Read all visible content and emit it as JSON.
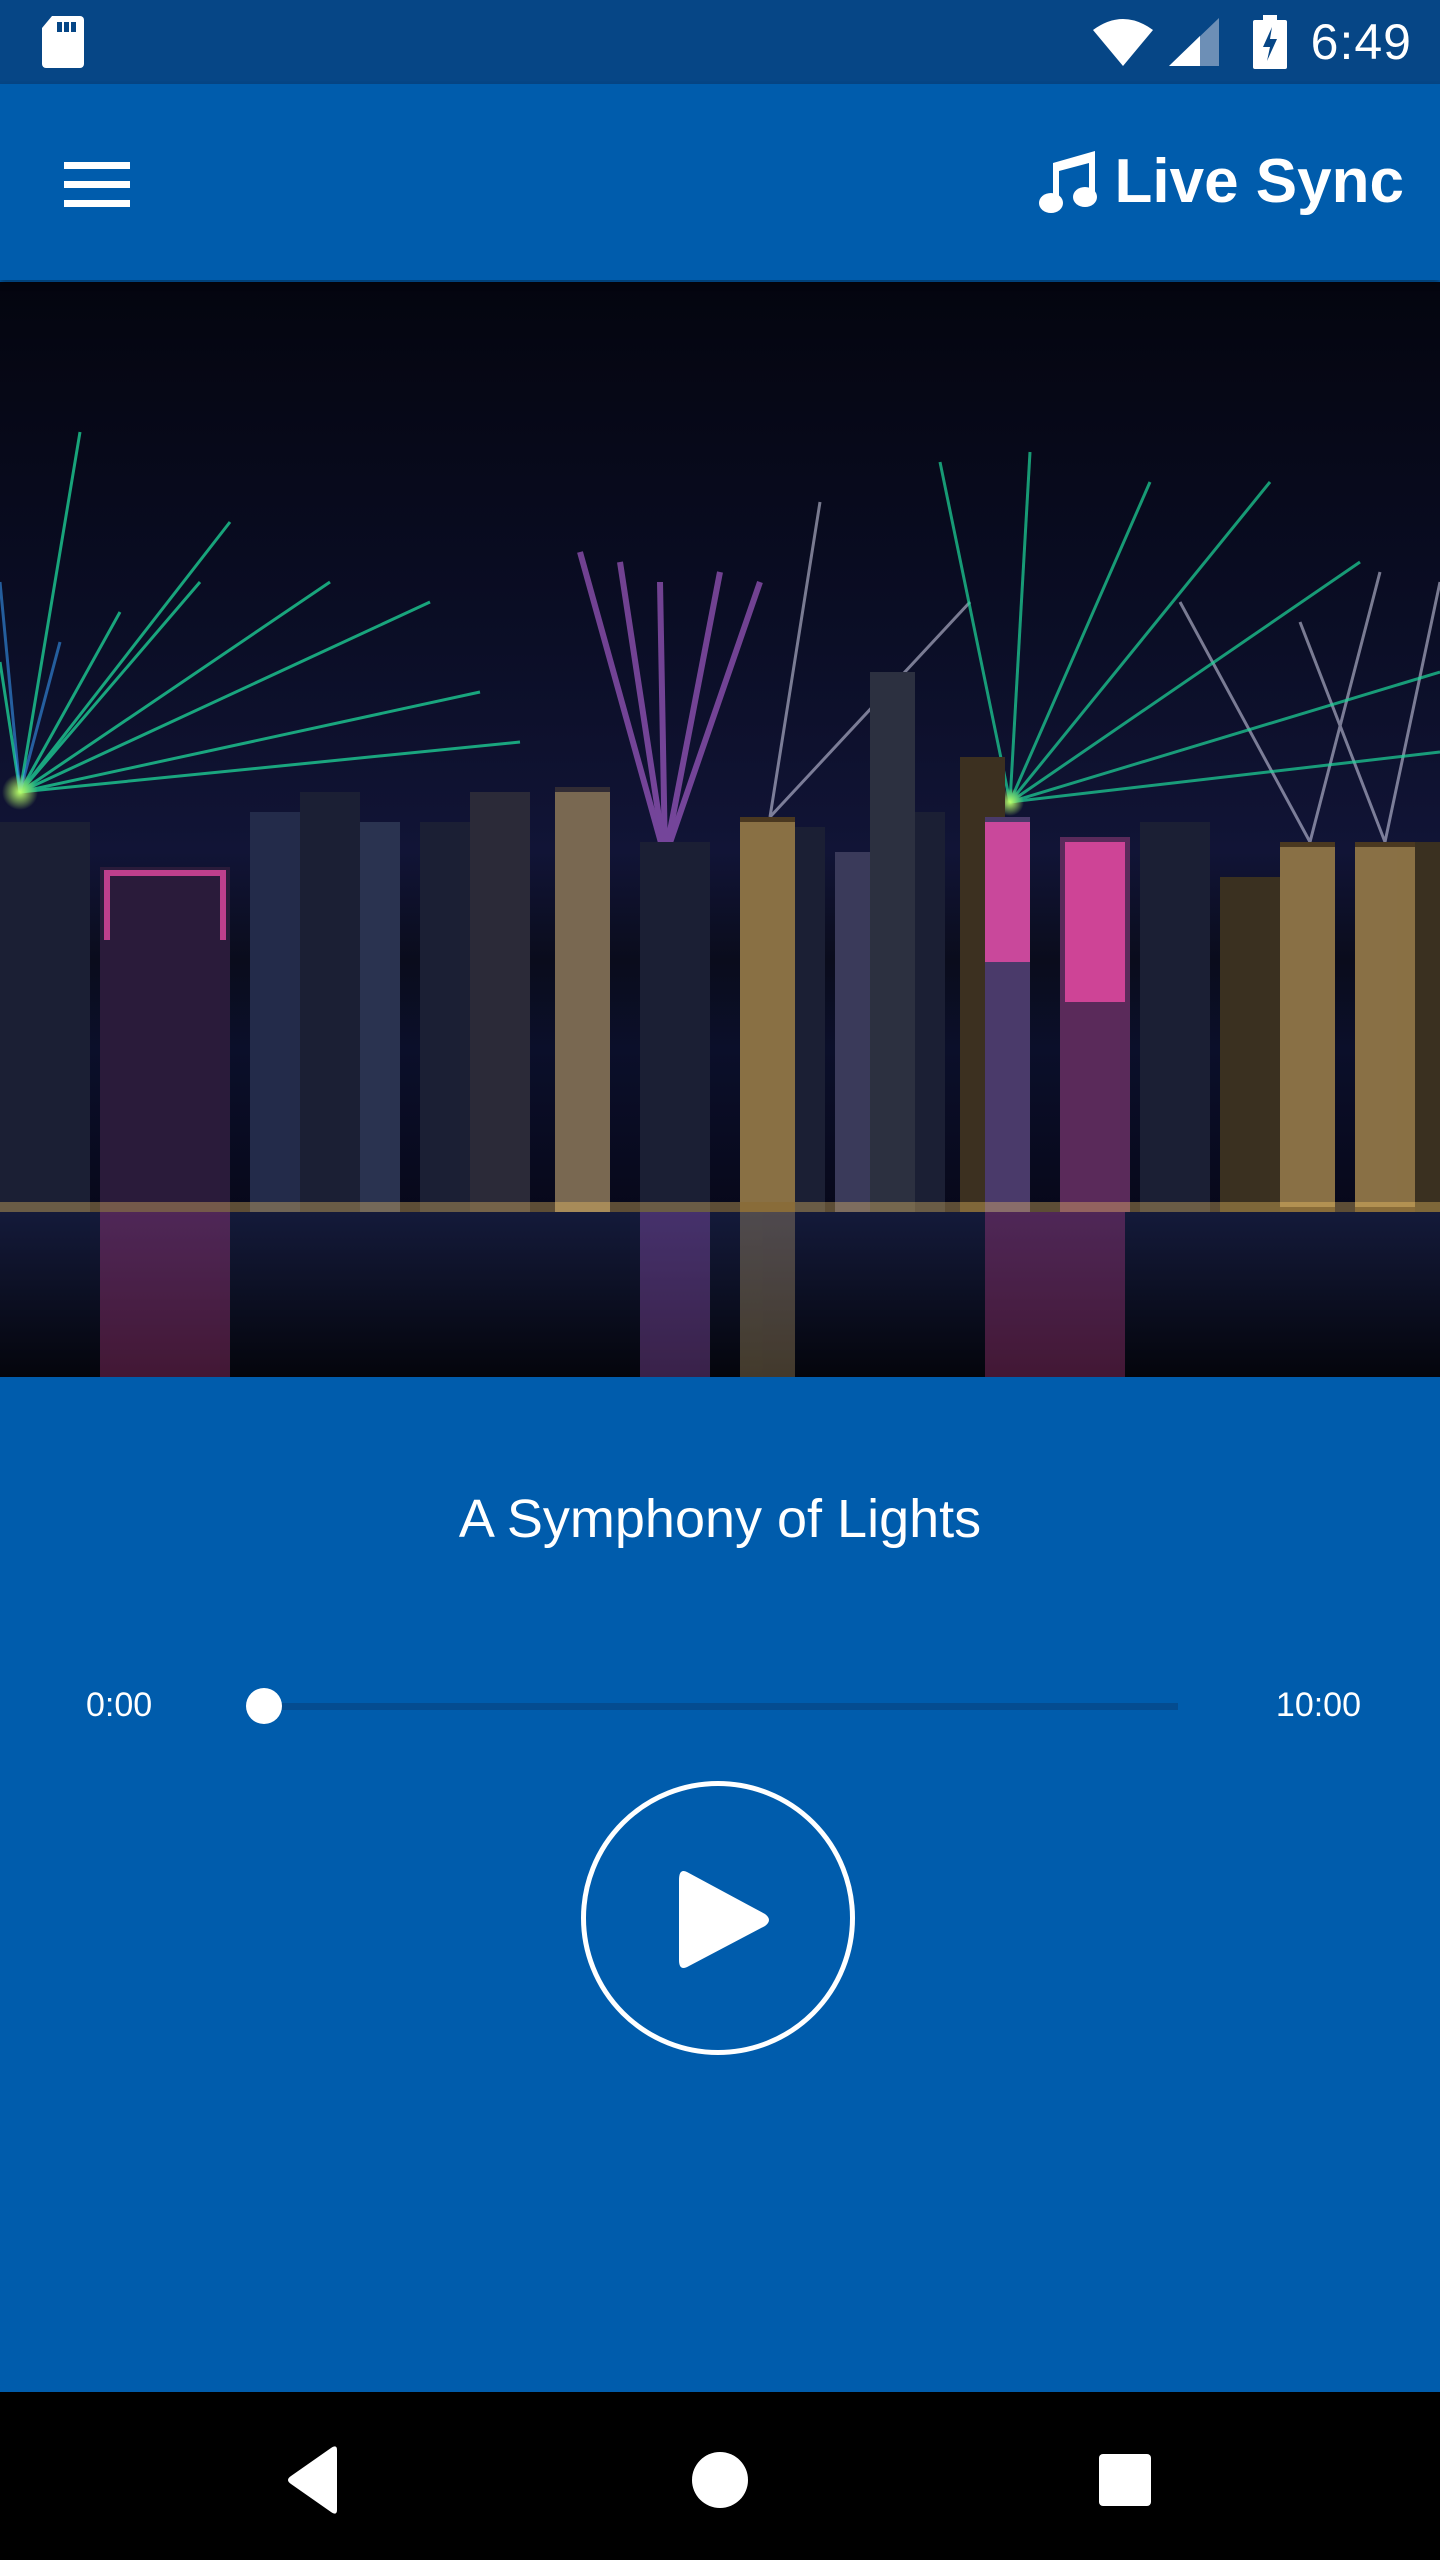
{
  "status_bar": {
    "time": "6:49",
    "icons": [
      "sd-card-icon",
      "wifi-icon",
      "cell-signal-icon",
      "battery-charging-icon"
    ]
  },
  "app_bar": {
    "title": "Live Sync",
    "menu_icon": "hamburger-menu-icon",
    "title_icon": "music-note-icon"
  },
  "hero": {
    "description": "Hong Kong skyline at night with laser light show over Victoria Harbour"
  },
  "player": {
    "track_title": "A Symphony of Lights",
    "elapsed": "0:00",
    "duration": "10:00",
    "progress": 0.0,
    "play_icon": "play-icon"
  },
  "nav_bar": {
    "buttons": [
      "back-icon",
      "home-icon",
      "recents-icon"
    ]
  },
  "colors": {
    "primary": "#005cac",
    "status_bar": "#064686",
    "seek_track": "#044c90",
    "nav_bar": "#000000",
    "foreground": "#ffffff"
  }
}
